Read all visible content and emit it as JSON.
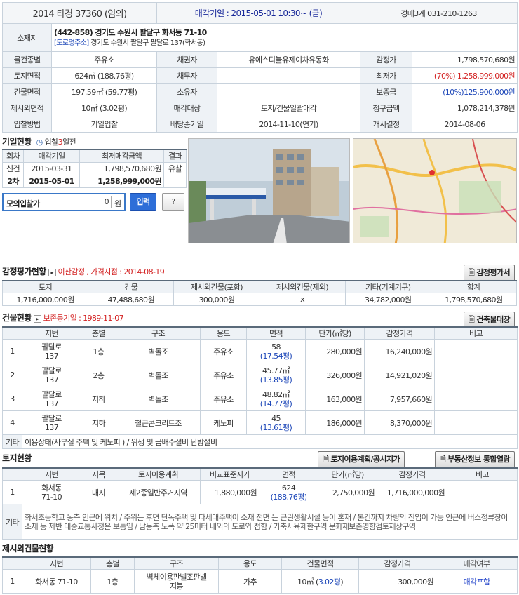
{
  "header": {
    "case_title": "2014 타경 37360 (임의)",
    "sale_date": "매각기일 : 2015-05-01   10:30~ (금)",
    "dept": "경매3계 031-210-1263"
  },
  "location": {
    "label": "소재지",
    "address": "(442-858) 경기도 수원시 팔달구 화서동 71-10",
    "road_tag": "[도로명주소]",
    "road_address": "경기도 수원시 팔달구 팔달로 137(화서동)"
  },
  "info_rows": [
    {
      "l1": "물건종별",
      "v1": "주유소",
      "l2": "채권자",
      "v2": "유에스디블유제이차유동화",
      "l3": "감정가",
      "v3": "1,798,570,680원"
    },
    {
      "l1": "토지면적",
      "v1": "624㎡ (188.76평)",
      "l2": "채무자",
      "v2": "",
      "l3": "최저가",
      "v3": "(70%) 1,258,999,000원"
    },
    {
      "l1": "건물면적",
      "v1": "197.59㎡ (59.77평)",
      "l2": "소유자",
      "v2": "",
      "l3": "보증금",
      "v3": "(10%)125,900,000원"
    },
    {
      "l1": "제시외면적",
      "v1": "10㎡ (3.02평)",
      "l2": "매각대상",
      "v2": "토지/건물일괄매각",
      "l3": "청구금액",
      "v3": "1,078,214,378원"
    },
    {
      "l1": "입찰방법",
      "v1": "기일입찰",
      "l2": "배당종기일",
      "v2": "2014-11-10(연기)",
      "l3": "개시결정",
      "v3": "2014-08-06"
    }
  ],
  "auction": {
    "title": "기일현황",
    "sub": "입찰3일전",
    "headers": [
      "회차",
      "매각기일",
      "최저매각금액",
      "결과"
    ],
    "rows": [
      [
        "신건",
        "2015-03-31",
        "1,798,570,680원",
        "유찰"
      ],
      [
        "2차",
        "2015-05-01",
        "1,258,999,000원",
        ""
      ]
    ],
    "mock_label": "모의입찰가",
    "mock_value": "0",
    "mock_unit": "원",
    "submit": "입력",
    "help": "?"
  },
  "appraisal": {
    "title": "감정평가현황",
    "sub": "이산감정 , 가격시점 : 2014-08-19",
    "button": "감정평가서",
    "headers": [
      "토지",
      "건물",
      "제시외건물(포함)",
      "제시외건물(제외)",
      "기타(기계기구)",
      "합계"
    ],
    "values": [
      "1,716,000,000원",
      "47,488,680원",
      "300,000원",
      "x",
      "34,782,000원",
      "1,798,570,680원"
    ]
  },
  "building": {
    "title": "건물현황",
    "sub": "보존등기일 : 1989-11-07",
    "button": "건축물대장",
    "headers": [
      "지번",
      "층별",
      "구조",
      "용도",
      "면적",
      "단가(㎡당)",
      "감정가격",
      "비고"
    ],
    "rows": [
      {
        "no": "1",
        "jibun": "팔달로\n137",
        "floor": "1층",
        "struct": "벽돌조",
        "use": "주유소",
        "area": "58",
        "area2": "(17.54평)",
        "unit": "280,000원",
        "price": "16,240,000원"
      },
      {
        "no": "2",
        "jibun": "팔달로\n137",
        "floor": "2층",
        "struct": "벽돌조",
        "use": "주유소",
        "area": "45.77㎡",
        "area2": "(13.85평)",
        "unit": "326,000원",
        "price": "14,921,020원"
      },
      {
        "no": "3",
        "jibun": "팔달로\n137",
        "floor": "지하",
        "struct": "벽돌조",
        "use": "주유소",
        "area": "48.82㎡",
        "area2": "(14.77평)",
        "unit": "163,000원",
        "price": "7,957,660원"
      },
      {
        "no": "4",
        "jibun": "팔달로\n137",
        "floor": "지하",
        "struct": "철근콘크리트조",
        "use": "케노피",
        "area": "45",
        "area2": "(13.61평)",
        "unit": "186,000원",
        "price": "8,370,000원"
      }
    ],
    "etc_label": "기타",
    "etc": "이용상태(사무실 주택 및 케노피 ) / 위생 및 급배수설비 난방설비"
  },
  "land": {
    "title": "토지현황",
    "button1": "토지이용계획/공시지가",
    "button2": "부동산정보 통합열람",
    "headers": [
      "지번",
      "지목",
      "토지이용계획",
      "비교표준지가",
      "면적",
      "단가(㎡당)",
      "감정가격",
      "비고"
    ],
    "row": {
      "no": "1",
      "jibun": "화서동\n71-10",
      "jimok": "대지",
      "plan": "제2종일반주거지역",
      "std": "1,880,000원",
      "area": "624",
      "area2": "(188.76평)",
      "unit": "2,750,000원",
      "price": "1,716,000,000원"
    },
    "etc_label": "기타",
    "etc": "화서초등학교 동측 인근에 위치 / 주위는 후면 단독주택 및 다세대주택이 소재 전면 는 근린생활시설 등이 혼재 / 본건까지 차량의 진입이 가능 인근에 버스정류장이 소재 등 제반 대중교통사정은 보통임 / 남동측 노폭 약 25미터 내외의 도로와 접함 / 가축사육제한구역 문화재보존영향검토재상구역"
  },
  "extra": {
    "title": "제시외건물현황",
    "headers": [
      "지번",
      "층별",
      "구조",
      "용도",
      "건물면적",
      "감정가격",
      "매각여부"
    ],
    "row": {
      "no": "1",
      "jibun": "화서동 71-10",
      "floor": "1층",
      "struct": "벽체이용판넬조판넬\n지붕",
      "use": "가추",
      "area": "10㎡ (",
      "area2": "3.02평",
      "area3": ")",
      "price": "300,000원",
      "status": "매각포함"
    }
  }
}
